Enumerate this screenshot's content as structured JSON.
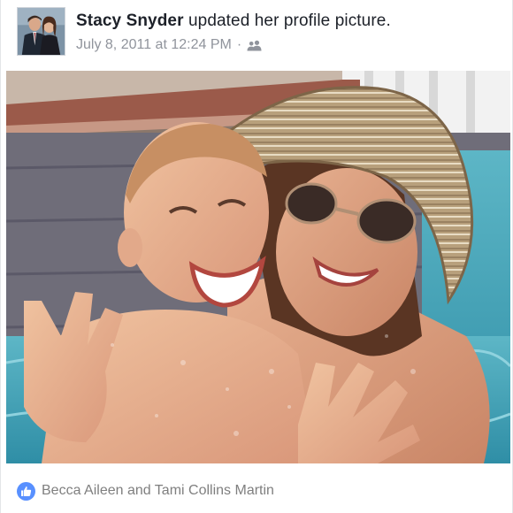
{
  "post": {
    "author": {
      "name": "Stacy Snyder",
      "avatar_icon": "profile-photo-couple"
    },
    "action_text": "updated her profile picture.",
    "timestamp": "July 8, 2011 at 12:24 PM",
    "separator": "·",
    "audience_icon": "friends-icon",
    "photo": {
      "description_icon": "photo-mother-and-son-in-pool"
    },
    "reactions": {
      "icon": "like-icon",
      "names_text": "Becca Aileen and Tami Collins Martin"
    }
  },
  "colors": {
    "like_blue": "#5890ff",
    "text_dark": "#1d2129",
    "text_meta": "#90949c",
    "text_reactors": "#7f7f7f",
    "pool_water": "#4aa0b6"
  }
}
